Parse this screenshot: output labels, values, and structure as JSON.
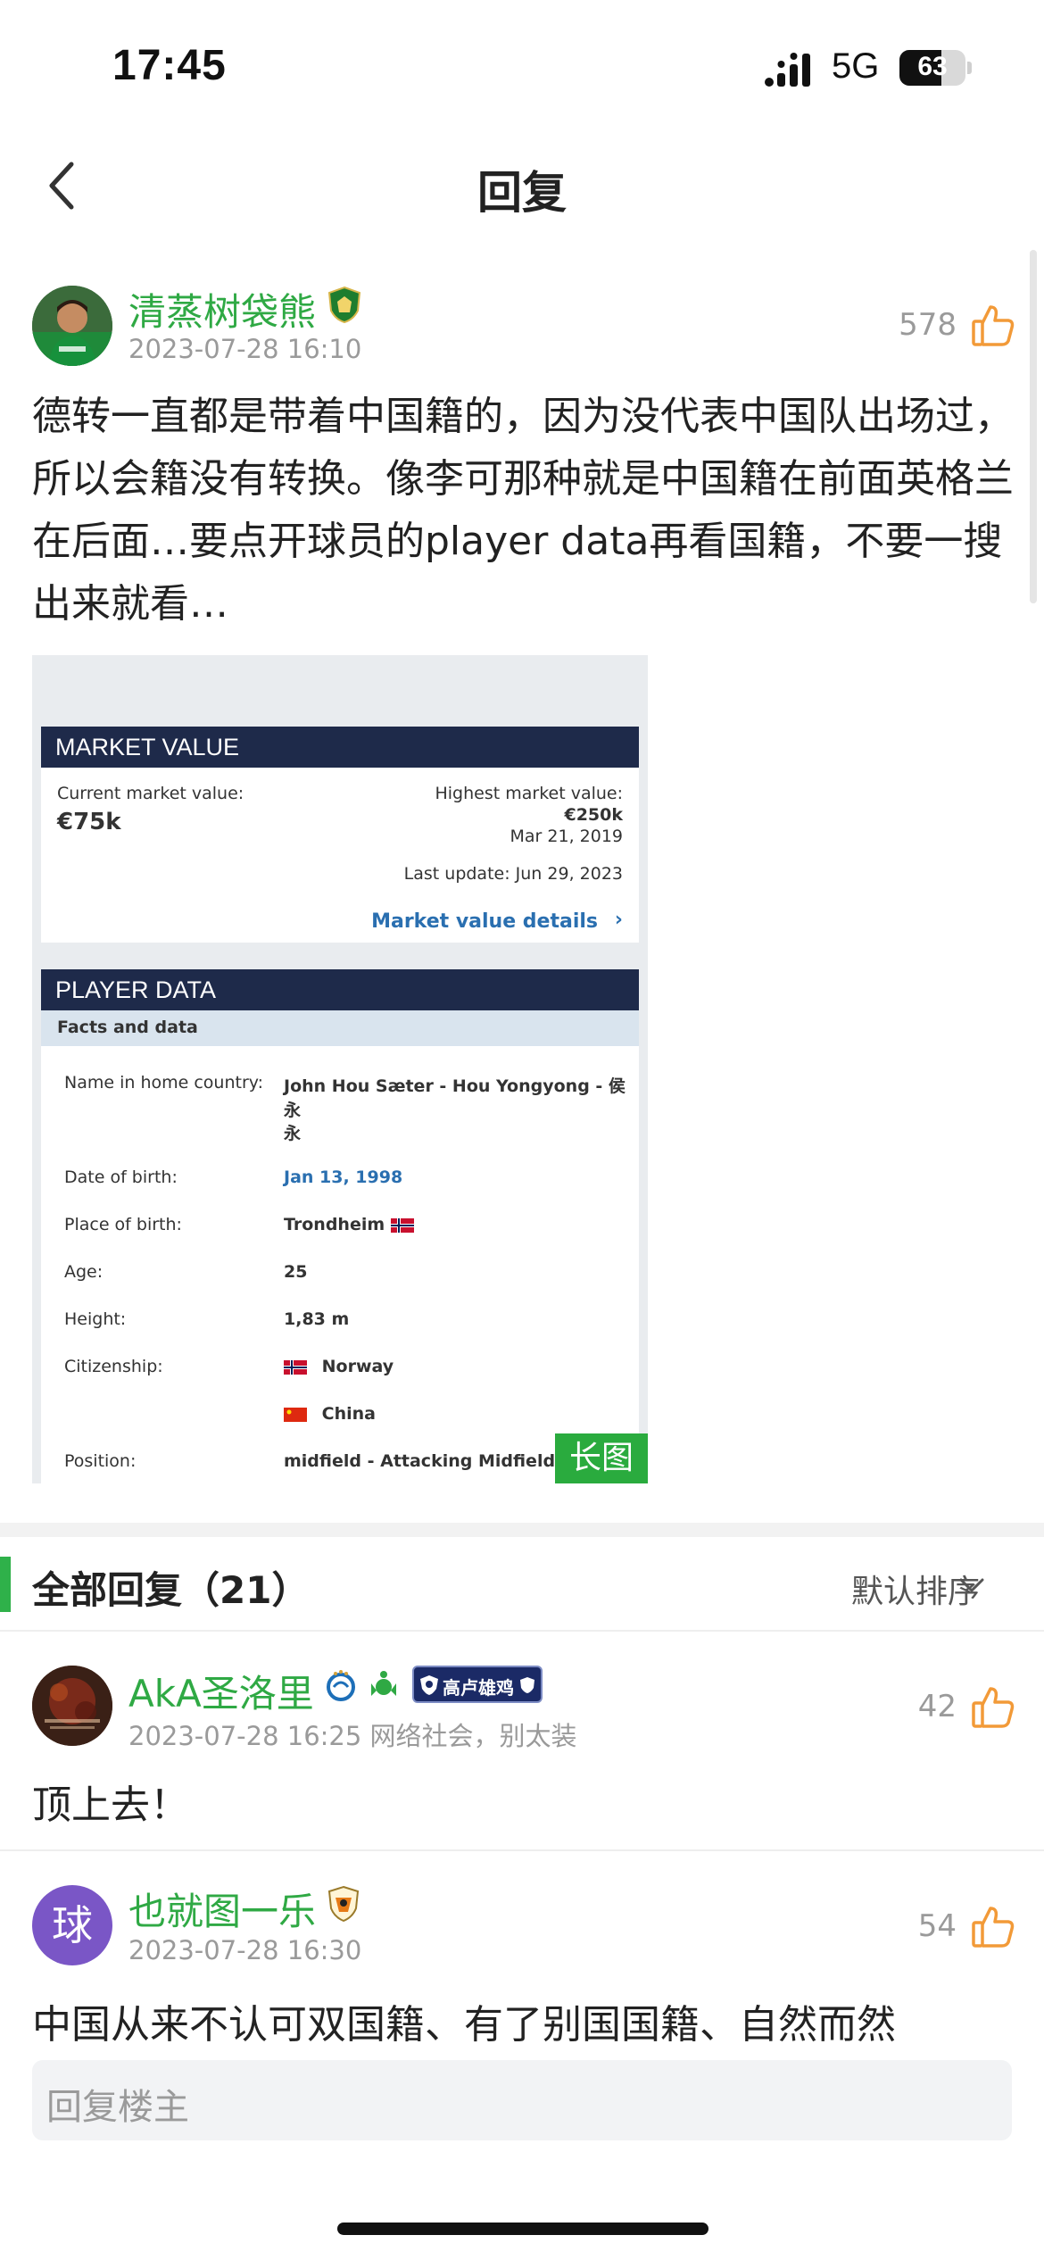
{
  "status_bar": {
    "time": "17:45",
    "network": "5G",
    "battery": "63",
    "battery_level_pct": 63
  },
  "nav": {
    "title": "回复"
  },
  "post": {
    "author": "清蒸树袋熊",
    "datetime": "2023-07-28 16:10",
    "likes": "578",
    "text": "德转一直都是带着中国籍的，因为没代表中国队出场过，所以会籍没有转换。像李可那种就是中国籍在前面英格兰在后面…要点开球员的player data再看国籍，不要一搜出来就看…",
    "image_tag": "长图",
    "image": {
      "market_value": {
        "header": "MARKET VALUE",
        "current_label": "Current market value:",
        "current_value": "€75k",
        "highest_label": "Highest market value:",
        "highest_value": "€250k",
        "highest_date": "Mar 21, 2019",
        "last_update": "Last update: Jun 29, 2023",
        "details_link": "Market value details"
      },
      "player_data": {
        "header": "PLAYER DATA",
        "subheader": "Facts and data",
        "rows": [
          {
            "label": "Name in home country:",
            "value": "John Hou Sæter - Hou Yongyong - 侯永",
            "value2": "永"
          },
          {
            "label": "Date of birth:",
            "value": "Jan 13, 1998"
          },
          {
            "label": "Place of birth:",
            "value": "Trondheim"
          },
          {
            "label": "Age:",
            "value": "25"
          },
          {
            "label": "Height:",
            "value": "1,83 m"
          },
          {
            "label": "Citizenship:",
            "value": "Norway",
            "value2": "China"
          },
          {
            "label": "Position:",
            "value": "midfield - Attacking Midfield"
          }
        ]
      }
    }
  },
  "replies_section": {
    "title": "全部回复（21）",
    "sort_label": "默认排序"
  },
  "comments": [
    {
      "author": "AkA圣洛里",
      "datetime": "2023-07-28 16:25",
      "meta": "网络社会，别太装",
      "likes": "42",
      "text": "顶上去！",
      "badge_text": "高卢雄鸡"
    },
    {
      "author": "也就图一乐",
      "datetime": "2023-07-28 16:30",
      "likes": "54",
      "avatar_char": "球",
      "text": "中国从来不认可双国籍、有了别国国籍、自然而然"
    }
  ],
  "reply_input": {
    "placeholder": "回复楼主"
  },
  "colors": {
    "username_green": "#2fa944",
    "like_orange": "#f29a38",
    "section_green": "#2fb14a",
    "tag_green": "#2aab3e",
    "navy_header": "#1e2a4a"
  },
  "icons": [
    "back-icon",
    "thumbs-up-icon",
    "chevron-down-icon",
    "signal-icon",
    "battery-icon"
  ]
}
